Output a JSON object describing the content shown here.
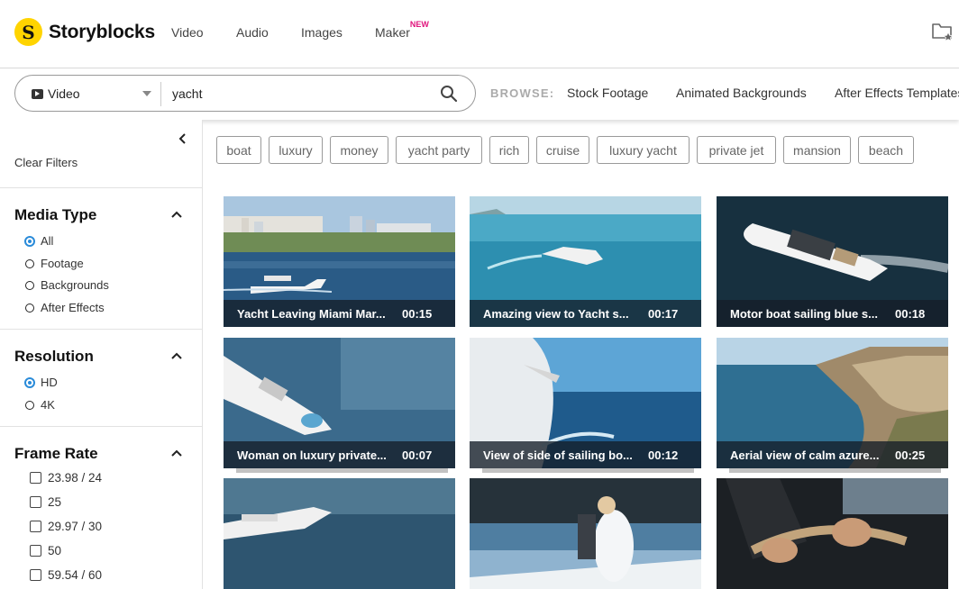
{
  "brand": {
    "name": "Storyblocks",
    "mark": "S"
  },
  "nav": {
    "items": [
      {
        "label": "Video"
      },
      {
        "label": "Audio"
      },
      {
        "label": "Images"
      },
      {
        "label": "Maker",
        "badge": "NEW"
      }
    ]
  },
  "search": {
    "media_type": "Video",
    "query": "yacht"
  },
  "browse": {
    "label": "BROWSE:",
    "links": [
      "Stock Footage",
      "Animated Backgrounds",
      "After Effects Templates"
    ]
  },
  "sidebar": {
    "clear_filters": "Clear Filters",
    "media_type": {
      "title": "Media Type",
      "options": [
        {
          "label": "All",
          "selected": true
        },
        {
          "label": "Footage",
          "selected": false
        },
        {
          "label": "Backgrounds",
          "selected": false
        },
        {
          "label": "After Effects",
          "selected": false
        }
      ]
    },
    "resolution": {
      "title": "Resolution",
      "options": [
        {
          "label": "HD",
          "selected": true
        },
        {
          "label": "4K",
          "selected": false
        }
      ]
    },
    "frame_rate": {
      "title": "Frame Rate",
      "options": [
        {
          "label": "23.98 / 24",
          "checked": false
        },
        {
          "label": "25",
          "checked": false
        },
        {
          "label": "29.97 / 30",
          "checked": false
        },
        {
          "label": "50",
          "checked": false
        },
        {
          "label": "59.54 / 60",
          "checked": false
        }
      ]
    }
  },
  "tags": [
    "boat",
    "luxury",
    "money",
    "yacht party",
    "rich",
    "cruise",
    "luxury yacht",
    "private jet",
    "mansion",
    "beach"
  ],
  "results": [
    {
      "title": "Yacht Leaving Miami Mar...",
      "duration": "00:15"
    },
    {
      "title": "Amazing view to Yacht s...",
      "duration": "00:17"
    },
    {
      "title": "Motor boat sailing blue s...",
      "duration": "00:18"
    },
    {
      "title": "Woman on luxury private...",
      "duration": "00:07"
    },
    {
      "title": "View of side of sailing bo...",
      "duration": "00:12"
    },
    {
      "title": "Aerial view of calm azure...",
      "duration": "00:25"
    },
    {
      "title": "",
      "duration": ""
    },
    {
      "title": "",
      "duration": ""
    },
    {
      "title": "",
      "duration": ""
    }
  ],
  "colors": {
    "brand_yellow": "#ffd400",
    "accent_blue": "#2a8bd9",
    "new_badge": "#e0137b"
  },
  "icons": [
    "play-icon",
    "chevron-down-icon",
    "search-icon",
    "folder-star-icon",
    "chevron-left-icon",
    "chevron-up-icon"
  ]
}
